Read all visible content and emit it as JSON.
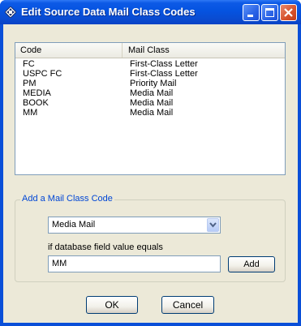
{
  "window": {
    "title": "Edit Source Data Mail Class Codes",
    "icon": "diamond-arrows-icon",
    "controls": [
      "minimize-icon",
      "maximize-icon",
      "close-icon"
    ]
  },
  "list": {
    "columns": {
      "code": "Code",
      "mail_class": "Mail Class"
    },
    "rows": [
      {
        "code": "FC",
        "mail_class": "First-Class Letter"
      },
      {
        "code": "USPC FC",
        "mail_class": "First-Class Letter"
      },
      {
        "code": "PM",
        "mail_class": "Priority Mail"
      },
      {
        "code": "MEDIA",
        "mail_class": "Media Mail"
      },
      {
        "code": "BOOK",
        "mail_class": "Media Mail"
      },
      {
        "code": "MM",
        "mail_class": "Media Mail"
      }
    ]
  },
  "add_group": {
    "label": "Add a Mail Class Code",
    "mail_class_selected": "Media Mail",
    "field_label": "if database field value equals",
    "field_value": "MM",
    "add_label": "Add"
  },
  "buttons": {
    "ok": "OK",
    "cancel": "Cancel"
  },
  "colors": {
    "titlebar": "#0553e0",
    "window_frame": "#0a4fd8",
    "client_bg": "#ece9d8",
    "group_label": "#0046d5",
    "close_button": "#d5502a"
  }
}
